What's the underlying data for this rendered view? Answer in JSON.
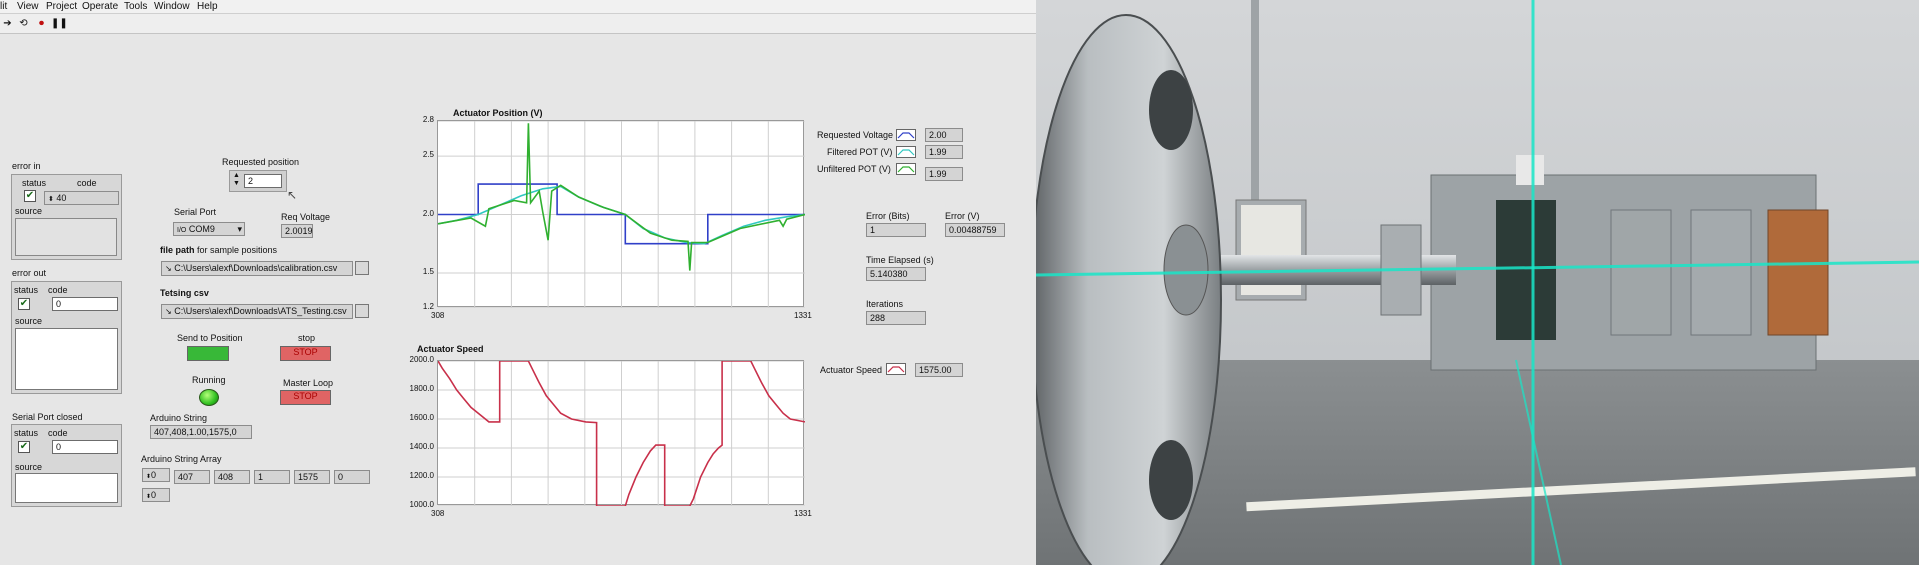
{
  "menu": [
    "lit",
    "View",
    "Project",
    "Operate",
    "Tools",
    "Window",
    "Help"
  ],
  "toolbar": {
    "run_icon": "run-arrow-icon",
    "run_cont_icon": "run-continuously-icon",
    "abort_icon": "abort-icon",
    "pause_icon": "pause-icon"
  },
  "error_in": {
    "title": "error in",
    "status_label": "status",
    "code_label": "code",
    "code_value": "40",
    "source_label": "source"
  },
  "error_out": {
    "title": "error out",
    "status_label": "status",
    "code_label": "code",
    "code_value": "0",
    "source_label": "source"
  },
  "serial_closed": {
    "title": "Serial Port closed",
    "status_label": "status",
    "code_label": "code",
    "code_value": "0",
    "source_label": "source"
  },
  "requested_position": {
    "label": "Requested position",
    "value": "2"
  },
  "serial_port": {
    "label": "Serial Port",
    "value": "COM9"
  },
  "req_voltage": {
    "label": "Req Voltage",
    "value": "2.0019"
  },
  "file_path": {
    "label_bold": "file path",
    "label_rest": " for sample positions",
    "value": "C:\\Users\\alexf\\Downloads\\calibration.csv"
  },
  "testing_csv": {
    "label": "Tetsing csv",
    "value": "C:\\Users\\alexf\\Downloads\\ATS_Testing.csv"
  },
  "send_to_position": {
    "label": "Send to Position"
  },
  "stop": {
    "label": "stop",
    "button": "STOP"
  },
  "running": {
    "label": "Running"
  },
  "master_loop": {
    "label": "Master Loop",
    "button": "STOP"
  },
  "arduino_string": {
    "label": "Arduino String",
    "value": "407,408,1.00,1575,0"
  },
  "arduino_array": {
    "label": "Arduino String Array",
    "index1": "0",
    "index2": "0",
    "values": [
      "407",
      "408",
      "1",
      "1575",
      "0"
    ]
  },
  "legend": [
    {
      "name": "Requested Voltage",
      "value": "2.00",
      "color": "#3040c8"
    },
    {
      "name": "Filtered POT (V)",
      "value": "1.99",
      "color": "#30c8c0"
    },
    {
      "name": "Unfiltered POT (V)",
      "value": "1.99",
      "color": "#30b030"
    }
  ],
  "indicators": {
    "error_bits": {
      "label": "Error (Bits)",
      "value": "1"
    },
    "error_v": {
      "label": "Error (V)",
      "value": "0.00488759"
    },
    "time_elapsed": {
      "label": "Time Elapsed (s)",
      "value": "5.140380"
    },
    "iterations": {
      "label": "Iterations",
      "value": "288"
    }
  },
  "speed_legend": {
    "name": "Actuator Speed",
    "value": "1575.00",
    "color": "#c8304a"
  },
  "chart_data": [
    {
      "type": "line",
      "title": "Actuator Position (V)",
      "xlim": [
        308,
        1331
      ],
      "ylim": [
        1.2,
        2.8
      ],
      "x_ticks": [
        "308",
        "1331"
      ],
      "y_ticks": [
        "2.8",
        "2.5",
        "2.0",
        "1.5",
        "1.2"
      ],
      "grid": true,
      "series": [
        {
          "name": "Requested Voltage",
          "color": "#3040c8",
          "points": [
            [
              308,
              2.0
            ],
            [
              420,
              2.0
            ],
            [
              420,
              2.26
            ],
            [
              640,
              2.26
            ],
            [
              640,
              2.0
            ],
            [
              830,
              2.0
            ],
            [
              830,
              1.75
            ],
            [
              1060,
              1.75
            ],
            [
              1060,
              2.0
            ],
            [
              1331,
              2.0
            ]
          ]
        },
        {
          "name": "Filtered POT (V)",
          "color": "#30c8c0",
          "points": [
            [
              308,
              1.92
            ],
            [
              360,
              1.95
            ],
            [
              420,
              2.0
            ],
            [
              480,
              2.08
            ],
            [
              540,
              2.16
            ],
            [
              600,
              2.22
            ],
            [
              650,
              2.24
            ],
            [
              700,
              2.15
            ],
            [
              760,
              2.07
            ],
            [
              830,
              2.0
            ],
            [
              880,
              1.88
            ],
            [
              940,
              1.8
            ],
            [
              1000,
              1.76
            ],
            [
              1050,
              1.75
            ],
            [
              1100,
              1.82
            ],
            [
              1160,
              1.9
            ],
            [
              1220,
              1.95
            ],
            [
              1280,
              1.98
            ],
            [
              1331,
              2.0
            ]
          ]
        },
        {
          "name": "Unfiltered POT (V)",
          "color": "#30b030",
          "points": [
            [
              308,
              1.92
            ],
            [
              400,
              1.97
            ],
            [
              440,
              1.9
            ],
            [
              450,
              2.05
            ],
            [
              520,
              2.12
            ],
            [
              555,
              2.1
            ],
            [
              560,
              2.78
            ],
            [
              566,
              2.1
            ],
            [
              590,
              2.2
            ],
            [
              600,
              2.02
            ],
            [
              615,
              1.78
            ],
            [
              625,
              2.2
            ],
            [
              650,
              2.25
            ],
            [
              700,
              2.15
            ],
            [
              770,
              2.06
            ],
            [
              830,
              2.0
            ],
            [
              900,
              1.84
            ],
            [
              960,
              1.78
            ],
            [
              1005,
              1.77
            ],
            [
              1010,
              1.52
            ],
            [
              1015,
              1.76
            ],
            [
              1060,
              1.76
            ],
            [
              1150,
              1.88
            ],
            [
              1260,
              1.95
            ],
            [
              1270,
              1.9
            ],
            [
              1280,
              1.96
            ],
            [
              1331,
              2.0
            ]
          ]
        }
      ]
    },
    {
      "type": "line",
      "title": "Actuator Speed",
      "xlim": [
        308,
        1331
      ],
      "ylim": [
        1000,
        2000
      ],
      "x_ticks": [
        "308",
        "1331"
      ],
      "y_ticks": [
        "2000.0",
        "1800.0",
        "1600.0",
        "1400.0",
        "1200.0",
        "1000.0"
      ],
      "grid": true,
      "series": [
        {
          "name": "Actuator Speed",
          "color": "#c8304a",
          "points": [
            [
              308,
              2000
            ],
            [
              320,
              1950
            ],
            [
              340,
              1880
            ],
            [
              360,
              1800
            ],
            [
              380,
              1740
            ],
            [
              400,
              1680
            ],
            [
              430,
              1620
            ],
            [
              450,
              1580
            ],
            [
              480,
              1580
            ],
            [
              480,
              2000
            ],
            [
              560,
              2000
            ],
            [
              570,
              1950
            ],
            [
              590,
              1850
            ],
            [
              610,
              1760
            ],
            [
              630,
              1700
            ],
            [
              650,
              1640
            ],
            [
              680,
              1600
            ],
            [
              720,
              1580
            ],
            [
              750,
              1575
            ],
            [
              750,
              1000
            ],
            [
              830,
              1000
            ],
            [
              840,
              1080
            ],
            [
              860,
              1200
            ],
            [
              880,
              1300
            ],
            [
              900,
              1380
            ],
            [
              915,
              1420
            ],
            [
              940,
              1420
            ],
            [
              940,
              1000
            ],
            [
              1010,
              1000
            ],
            [
              1020,
              1050
            ],
            [
              1040,
              1200
            ],
            [
              1060,
              1300
            ],
            [
              1075,
              1360
            ],
            [
              1090,
              1400
            ],
            [
              1100,
              1420
            ],
            [
              1100,
              2000
            ],
            [
              1180,
              2000
            ],
            [
              1190,
              1950
            ],
            [
              1210,
              1850
            ],
            [
              1230,
              1760
            ],
            [
              1250,
              1700
            ],
            [
              1270,
              1640
            ],
            [
              1290,
              1600
            ],
            [
              1331,
              1580
            ]
          ]
        }
      ]
    }
  ]
}
